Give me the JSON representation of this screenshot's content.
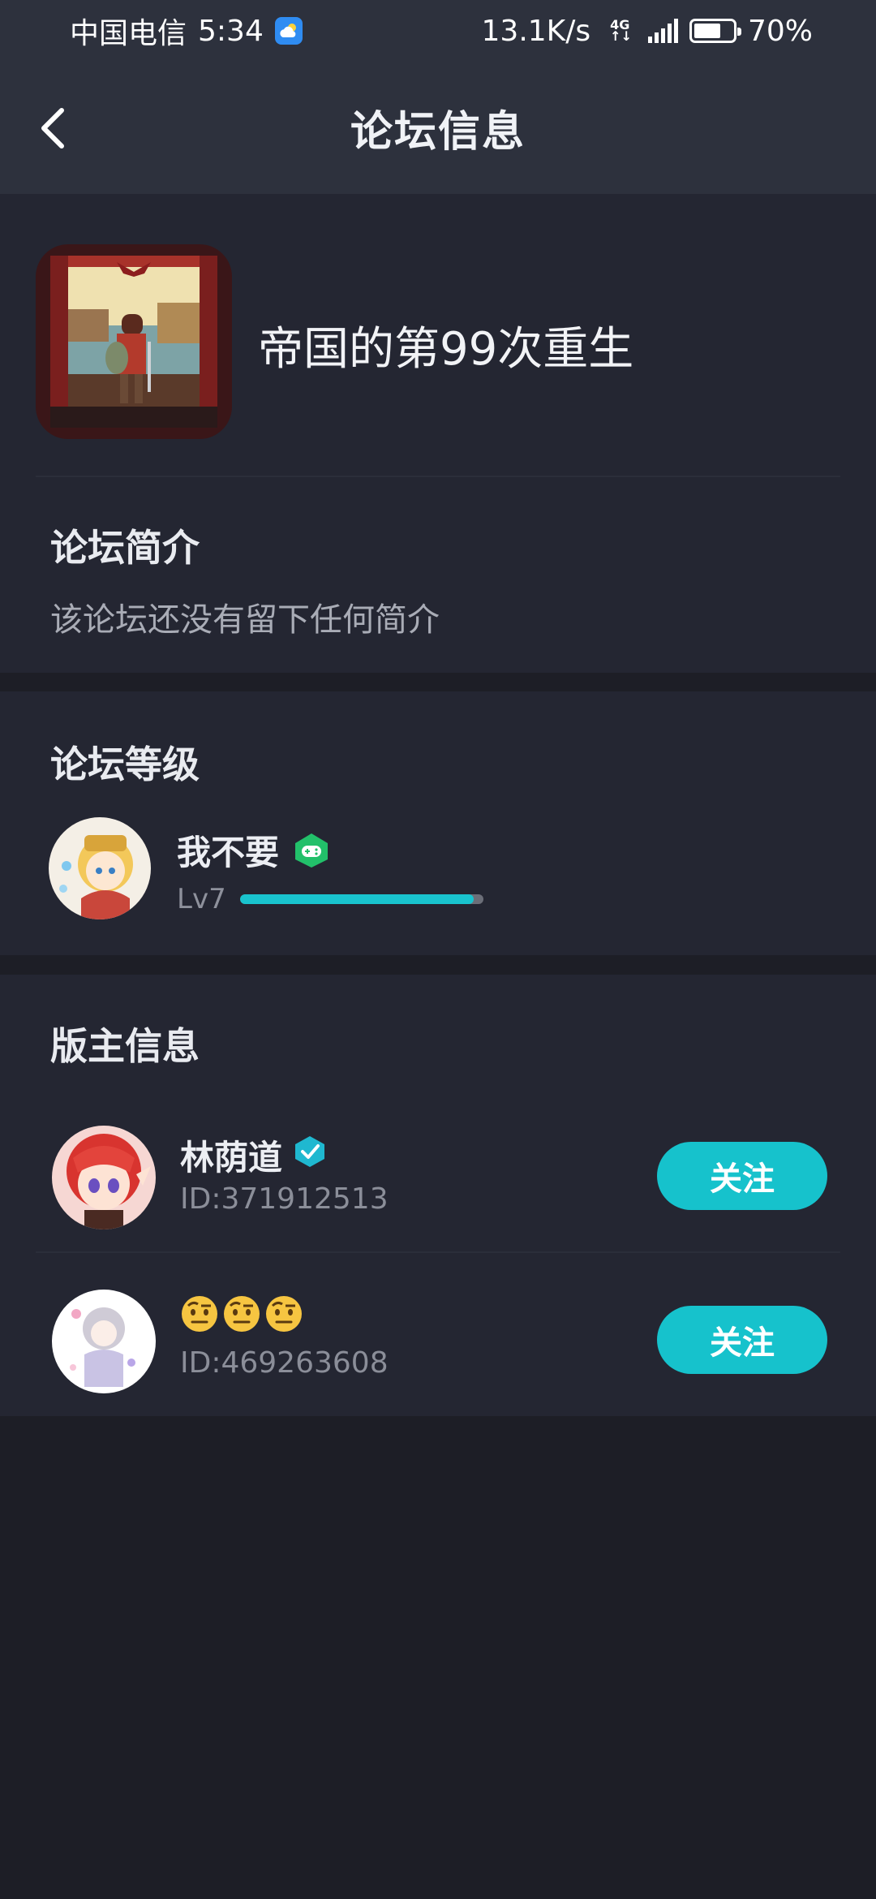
{
  "status_bar": {
    "carrier": "中国电信",
    "time": "5:34",
    "net_speed": "13.1K/s",
    "network_type": "4G",
    "battery_percent": "70%",
    "battery_level": 0.7
  },
  "header": {
    "title": "论坛信息",
    "back_icon": "chevron-left-icon"
  },
  "forum": {
    "name": "帝国的第99次重生",
    "intro_title": "论坛简介",
    "intro_text": "该论坛还没有留下任何简介"
  },
  "level": {
    "section_title": "论坛等级",
    "user_name": "我不要",
    "level_label": "Lv7",
    "progress": 0.96,
    "badge_icon": "game-controller-badge-icon"
  },
  "moderators": {
    "section_title": "版主信息",
    "items": [
      {
        "name": "林荫道",
        "id_text": "ID:371912513",
        "follow_label": "关注",
        "verified": true
      },
      {
        "name": "🤨🤨🤨",
        "id_text": "ID:469263608",
        "follow_label": "关注",
        "verified": false
      }
    ]
  },
  "colors": {
    "accent": "#16c2cc",
    "background": "#1d1e26",
    "card": "#242632",
    "header": "#2d313d"
  }
}
